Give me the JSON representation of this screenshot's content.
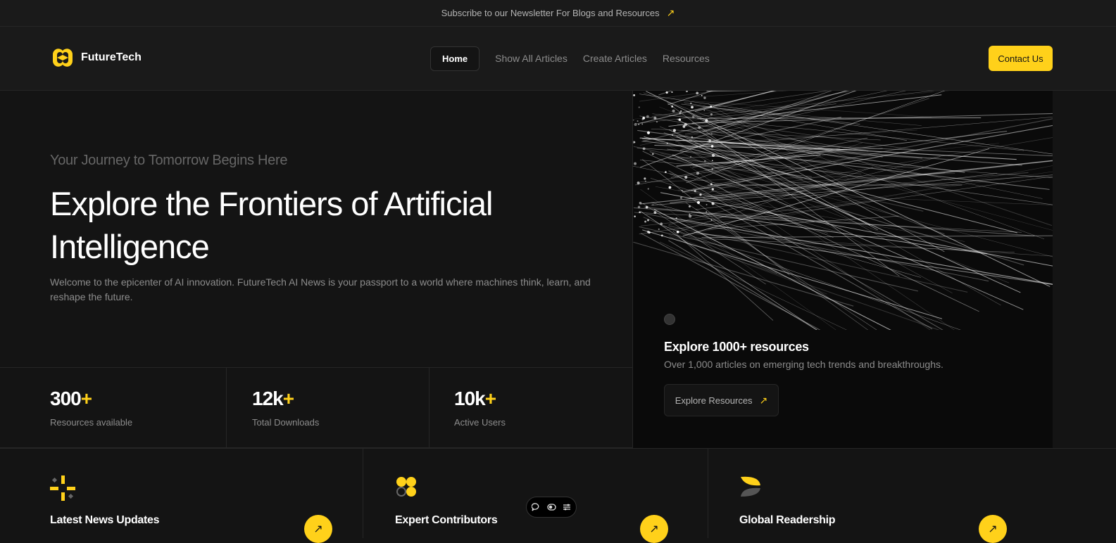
{
  "announcement": {
    "text": "Subscribe to our Newsletter For Blogs and Resources",
    "icon": "arrow-up-right-icon"
  },
  "brand": {
    "name": "FutureTech",
    "accent": "#ffd11a"
  },
  "nav": {
    "items": [
      {
        "label": "Home",
        "active": true
      },
      {
        "label": "Show All Articles",
        "active": false
      },
      {
        "label": "Create Articles",
        "active": false
      },
      {
        "label": "Resources",
        "active": false
      }
    ],
    "cta_label": "Contact Us"
  },
  "hero": {
    "tagline": "Your Journey to Tomorrow Begins Here",
    "headline": "Explore the Frontiers of Artificial Intelligence",
    "description": "Welcome to the epicenter of AI innovation. FutureTech AI News is your passport to a world where machines think, learn, and reshape the future."
  },
  "stats": [
    {
      "value": "300",
      "suffix": "+",
      "label": "Resources available"
    },
    {
      "value": "12k",
      "suffix": "+",
      "label": "Total Downloads"
    },
    {
      "value": "10k",
      "suffix": "+",
      "label": "Active Users"
    }
  ],
  "resources_card": {
    "title": "Explore 1000+ resources",
    "description": "Over 1,000 articles on emerging tech trends and breakthroughs.",
    "button_label": "Explore Resources"
  },
  "features": [
    {
      "title": "Latest News Updates",
      "icon": "sparkle-icon"
    },
    {
      "title": "Expert Contributors",
      "icon": "clover-icon"
    },
    {
      "title": "Global Readership",
      "icon": "leaf-icon"
    }
  ],
  "floating_toolbar": {
    "icons": [
      "comment-icon",
      "toggle-icon",
      "settings-icon"
    ]
  }
}
